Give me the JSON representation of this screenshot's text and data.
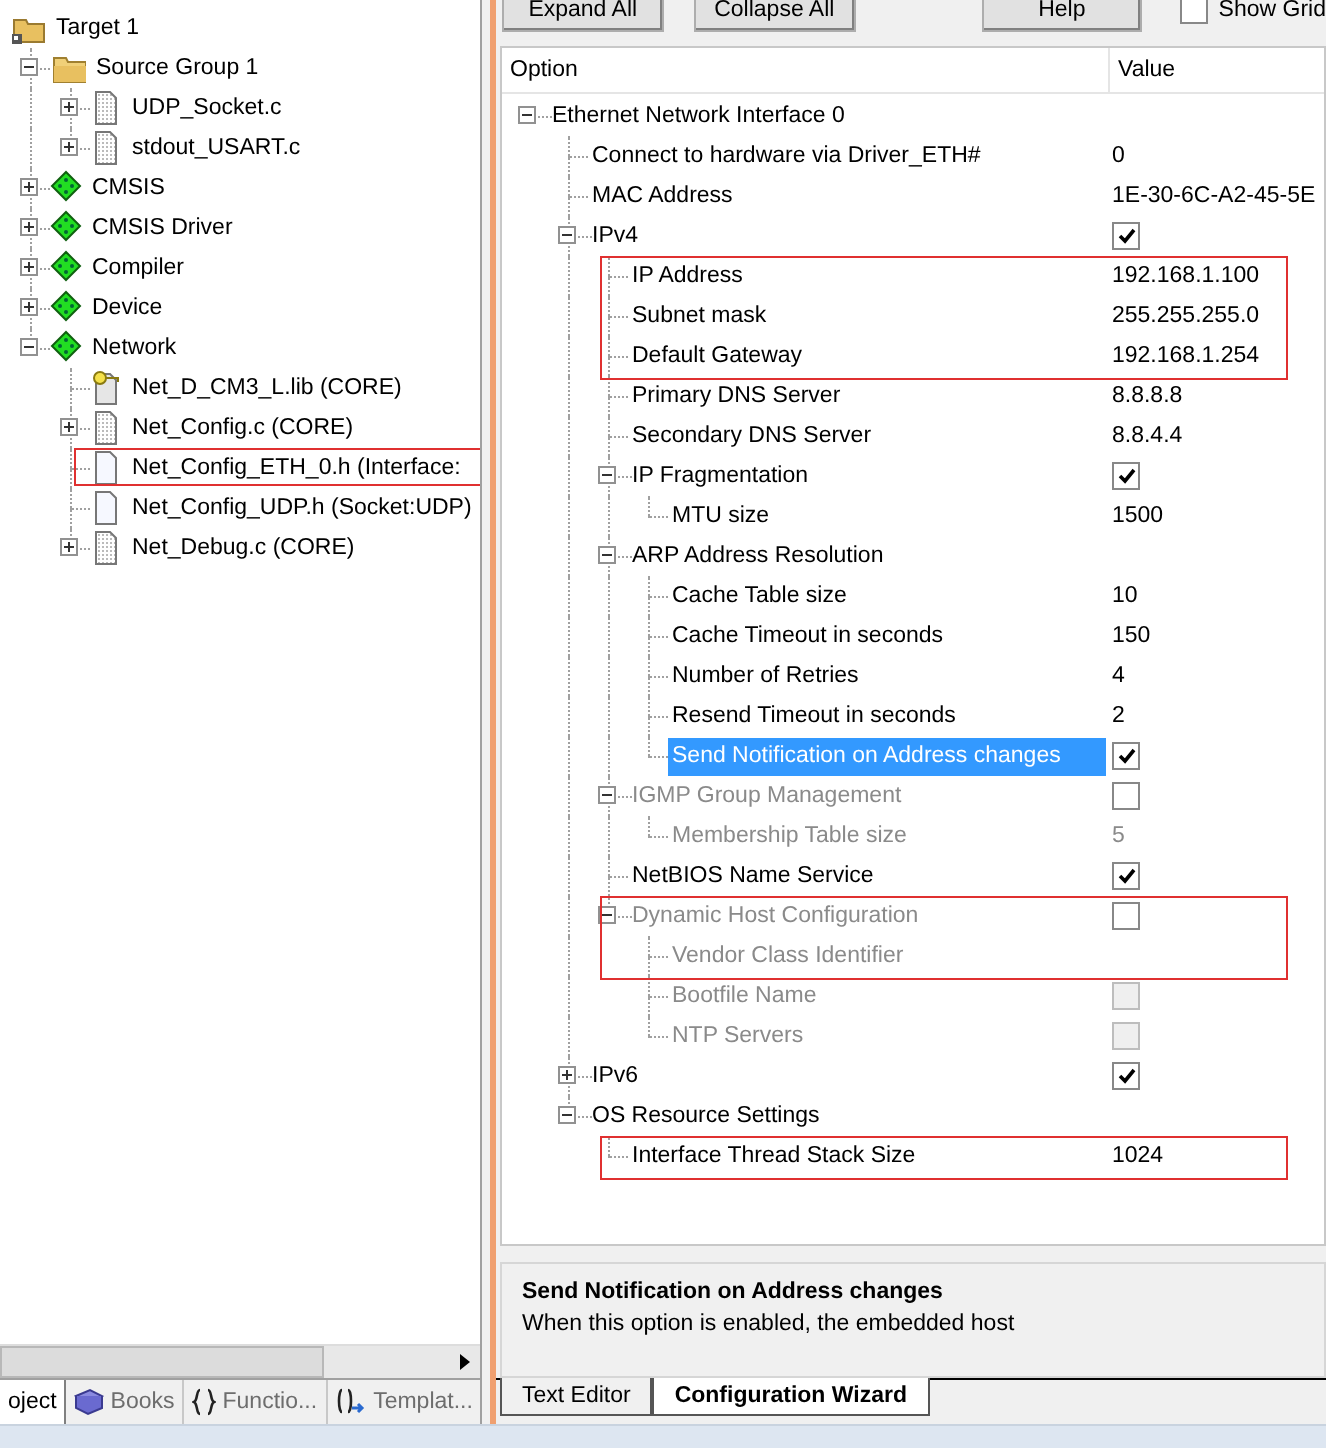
{
  "project_tree": {
    "items": [
      {
        "label": "Target 1",
        "kind": "target",
        "children": [
          {
            "label": "Source Group 1",
            "kind": "folder",
            "expanded": true,
            "children": [
              {
                "label": "UDP_Socket.c",
                "kind": "source",
                "expanded": false
              },
              {
                "label": "stdout_USART.c",
                "kind": "source",
                "expanded": false
              }
            ]
          },
          {
            "label": "CMSIS",
            "kind": "component",
            "expanded": false
          },
          {
            "label": "CMSIS Driver",
            "kind": "component",
            "expanded": false
          },
          {
            "label": "Compiler",
            "kind": "component",
            "expanded": false
          },
          {
            "label": "Device",
            "kind": "component",
            "expanded": false
          },
          {
            "label": "Network",
            "kind": "component",
            "expanded": true,
            "children": [
              {
                "label": "Net_D_CM3_L.lib (CORE)",
                "kind": "library"
              },
              {
                "label": "Net_Config.c (CORE)",
                "kind": "source",
                "expanded": false
              },
              {
                "label": "Net_Config_ETH_0.h (Interface:",
                "kind": "header",
                "marked": true
              },
              {
                "label": "Net_Config_UDP.h (Socket:UDP)",
                "kind": "header"
              },
              {
                "label": "Net_Debug.c (CORE)",
                "kind": "source",
                "expanded": false
              }
            ]
          }
        ]
      }
    ]
  },
  "left_tabs": [
    {
      "label": "oject",
      "kind": "project",
      "selected": true
    },
    {
      "label": "Books",
      "kind": "books",
      "selected": false
    },
    {
      "label": "Functio...",
      "kind": "functions",
      "selected": false
    },
    {
      "label": "Templat...",
      "kind": "templates",
      "selected": false
    }
  ],
  "toolbar": {
    "buttons": [
      "Expand All",
      "Collapse All",
      "Help"
    ],
    "show_grid": {
      "label": "Show Grid",
      "checked": false
    }
  },
  "config": {
    "columns": [
      "Option",
      "Value"
    ],
    "items": [
      {
        "label": "Ethernet Network Interface 0",
        "kind": "group",
        "expanded": true,
        "children": [
          {
            "label": "Connect to hardware via Driver_ETH#",
            "kind": "text",
            "value": "0"
          },
          {
            "label": "MAC Address",
            "kind": "text",
            "value": "1E-30-6C-A2-45-5E"
          },
          {
            "label": "IPv4",
            "kind": "check",
            "checked": true,
            "expanded": true,
            "children": [
              {
                "label": "IP Address",
                "kind": "text",
                "value": "192.168.1.100",
                "marked": true
              },
              {
                "label": "Subnet mask",
                "kind": "text",
                "value": "255.255.255.0",
                "marked": true
              },
              {
                "label": "Default Gateway",
                "kind": "text",
                "value": "192.168.1.254",
                "marked": true
              },
              {
                "label": "Primary DNS Server",
                "kind": "text",
                "value": "8.8.8.8"
              },
              {
                "label": "Secondary DNS Server",
                "kind": "text",
                "value": "8.8.4.4"
              },
              {
                "label": "IP Fragmentation",
                "kind": "check",
                "checked": true,
                "expanded": true,
                "children": [
                  {
                    "label": "MTU size",
                    "kind": "text",
                    "value": "1500"
                  }
                ]
              },
              {
                "label": "ARP Address Resolution",
                "kind": "group",
                "expanded": true,
                "children": [
                  {
                    "label": "Cache Table size",
                    "kind": "text",
                    "value": "10"
                  },
                  {
                    "label": "Cache Timeout in seconds",
                    "kind": "text",
                    "value": "150"
                  },
                  {
                    "label": "Number of Retries",
                    "kind": "text",
                    "value": "4"
                  },
                  {
                    "label": "Resend Timeout in seconds",
                    "kind": "text",
                    "value": "2"
                  },
                  {
                    "label": "Send Notification on Address changes",
                    "kind": "check",
                    "checked": true,
                    "selected": true
                  }
                ]
              },
              {
                "label": "IGMP Group Management",
                "kind": "check",
                "checked": false,
                "disabled": true,
                "expanded": true,
                "children": [
                  {
                    "label": "Membership Table size",
                    "kind": "text",
                    "value": "5",
                    "disabled": true
                  }
                ]
              },
              {
                "label": "NetBIOS Name Service",
                "kind": "check",
                "checked": true
              },
              {
                "label": "Dynamic Host Configuration",
                "kind": "check",
                "checked": false,
                "disabled": true,
                "marked": true,
                "expanded": true,
                "children": [
                  {
                    "label": "Vendor Class Identifier",
                    "kind": "group",
                    "disabled": true,
                    "marked": true
                  },
                  {
                    "label": "Bootfile Name",
                    "kind": "locked_check",
                    "checked": false,
                    "disabled": true
                  },
                  {
                    "label": "NTP Servers",
                    "kind": "locked_check",
                    "checked": false,
                    "disabled": true
                  }
                ]
              }
            ]
          },
          {
            "label": "IPv6",
            "kind": "check",
            "checked": true,
            "expanded": false
          },
          {
            "label": "OS Resource Settings",
            "kind": "group",
            "expanded": true,
            "children": [
              {
                "label": "Interface Thread Stack Size",
                "kind": "text",
                "value": "1024",
                "marked": true
              }
            ]
          }
        ]
      }
    ]
  },
  "help": {
    "title": "Send Notification on Address changes",
    "text": "When this option is enabled, the embedded host"
  },
  "editor_tabs": [
    {
      "label": "Text Editor",
      "selected": false
    },
    {
      "label": "Configuration Wizard",
      "selected": true
    }
  ]
}
